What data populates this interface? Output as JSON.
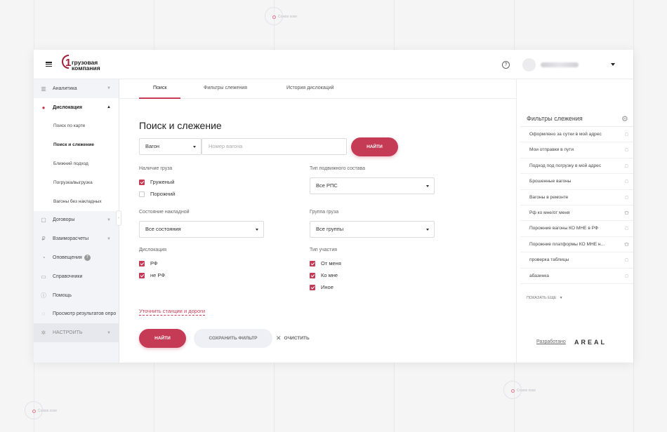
{
  "background": {
    "marker_label": "Coмos xoxe"
  },
  "header": {
    "logo_number": "1",
    "logo_line1": "грузовая",
    "logo_line2": "компания",
    "help_label": "?"
  },
  "sidebar": {
    "items": [
      {
        "label": "Аналитика",
        "icon": "chart-icon"
      },
      {
        "label": "Дислокация",
        "icon": "map-pin-icon"
      },
      {
        "label": "Договоры",
        "icon": "document-icon"
      },
      {
        "label": "Взаиморасчеты",
        "icon": "ruble-icon"
      },
      {
        "label": "Оповещения",
        "icon": "bell-icon",
        "badge": "7"
      },
      {
        "label": "Справочники",
        "icon": "book-icon"
      },
      {
        "label": "Помощь",
        "icon": "info-icon"
      },
      {
        "label": "Просмотр результатов опро",
        "icon": "poll-icon"
      },
      {
        "label": "НАСТРОИТЬ",
        "icon": "gear-icon"
      }
    ],
    "subitems": [
      "Поиск по карте",
      "Поиск и слежение",
      "Ближний подход",
      "Погрузка/выгрузка",
      "Вагоны без накладных"
    ]
  },
  "tabs": [
    {
      "label": "Поиск"
    },
    {
      "label": "Фильтры слежения"
    },
    {
      "label": "История дислокаций"
    }
  ],
  "main": {
    "title": "Поиск и слежение",
    "search_type": "Вагон",
    "search_placeholder": "Номер вагона",
    "find_top": "НАЙТИ",
    "cargo_label": "Наличие груза",
    "cargo_options": [
      {
        "label": "Груженый",
        "checked": true
      },
      {
        "label": "Порожний",
        "checked": false
      }
    ],
    "rolling_label": "Тип подвижного состава",
    "rolling_value": "Все РПС",
    "waybill_label": "Состояние накладной",
    "waybill_value": "Все состояния",
    "cargo_group_label": "Группа груза",
    "cargo_group_value": "Все группы",
    "dislocation_label": "Дислокация",
    "dislocation_options": [
      {
        "label": "РФ",
        "checked": true
      },
      {
        "label": "не РФ",
        "checked": true
      }
    ],
    "participation_label": "Тип участия",
    "participation_options": [
      {
        "label": "От меня",
        "checked": true
      },
      {
        "label": "Ко мне",
        "checked": true
      },
      {
        "label": "Иное",
        "checked": true
      }
    ],
    "refine_link": "Уточнить станции и дороги",
    "find_bottom": "НАЙТИ",
    "save_filter": "СОХРАНИТЬ ФИЛЬТР",
    "clear": "ОЧИСТИТЬ"
  },
  "right_panel": {
    "title": "Фильтры слежения",
    "filters": [
      "Оформлено за сутки в мой адрес",
      "Мои отправки в пути",
      "Подход под погрузку в мой адрес",
      "Брошенные вагоны",
      "Вагоны в ремонте",
      "Рф ко мне/от меня",
      "Порожние вагоны КО МНЕ в РФ",
      "Порожние платформы КО МНЕ н...",
      "проверка таблицы",
      "абазинка"
    ],
    "show_more": "ПОКАЗАТЬ ЕЩЕ",
    "developed_by": "Разработано",
    "vendor": "AREAL"
  },
  "colors": {
    "accent": "#c53b55",
    "sidebar_bg": "#f3f4f8"
  }
}
